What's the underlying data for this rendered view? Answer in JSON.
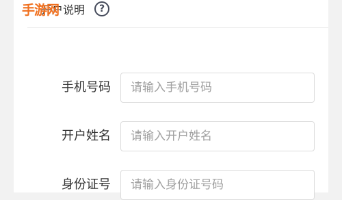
{
  "header": {
    "title": "开户说明",
    "watermark": "手游网",
    "help_glyph": "?"
  },
  "form": {
    "fields": [
      {
        "label": "手机号码",
        "placeholder": "请输入手机号码",
        "value": ""
      },
      {
        "label": "开户姓名",
        "placeholder": "请输入开户姓名",
        "value": ""
      },
      {
        "label": "身份证号",
        "placeholder": "请输入身份证号码",
        "value": ""
      }
    ]
  },
  "colors": {
    "watermark": "#f0701f",
    "help_icon": "#444a5a",
    "input_border": "#dcdcdc",
    "placeholder": "#a0a0a0"
  }
}
